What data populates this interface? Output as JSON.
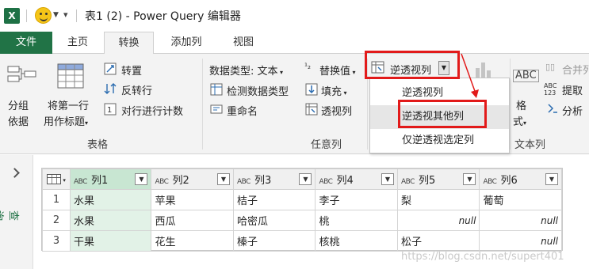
{
  "titlebar": {
    "app_icon": "X",
    "title": "表1 (2) - Power Query 编辑器"
  },
  "tabs": [
    "文件",
    "主页",
    "转换",
    "添加列",
    "视图"
  ],
  "ribbon": {
    "group_table": {
      "label": "表格",
      "group_by_line1": "分组",
      "group_by_line2": "依据",
      "first_row_line1": "将第一行",
      "first_row_line2": "用作标题",
      "transpose": "转置",
      "reverse_rows": "反转行",
      "count_rows": "对行进行计数"
    },
    "group_any_column": {
      "label": "任意列",
      "data_type": "数据类型: 文本",
      "detect_type": "检测数据类型",
      "rename": "重命名",
      "replace_values": "替换值",
      "fill": "填充",
      "pivot": "透视列",
      "unpivot": "逆透视列"
    },
    "group_text_column": {
      "label": "文本列",
      "format_line1": "格",
      "format_line2": "式",
      "merge": "合并列",
      "extract": "提取",
      "parse": "分析"
    }
  },
  "dropdown": {
    "items": [
      "逆透视列",
      "逆透视其他列",
      "仅逆透视选定列"
    ]
  },
  "query_pane": {
    "label": "查询"
  },
  "grid": {
    "type_label": "ABC",
    "columns": [
      "列1",
      "列2",
      "列3",
      "列4",
      "列5",
      "列6"
    ],
    "rows": [
      [
        "1",
        "水果",
        "苹果",
        "桔子",
        "李子",
        "梨",
        "葡萄"
      ],
      [
        "2",
        "水果",
        "西瓜",
        "哈密瓜",
        "桃",
        "null",
        "null"
      ],
      [
        "3",
        "干果",
        "花生",
        "榛子",
        "核桃",
        "松子",
        "null"
      ]
    ]
  },
  "watermark": "https://blog.csdn.net/supert401",
  "colors": {
    "excel_green": "#217346",
    "highlight_red": "#e21a1a",
    "selected_column": "#c8e6d2"
  }
}
